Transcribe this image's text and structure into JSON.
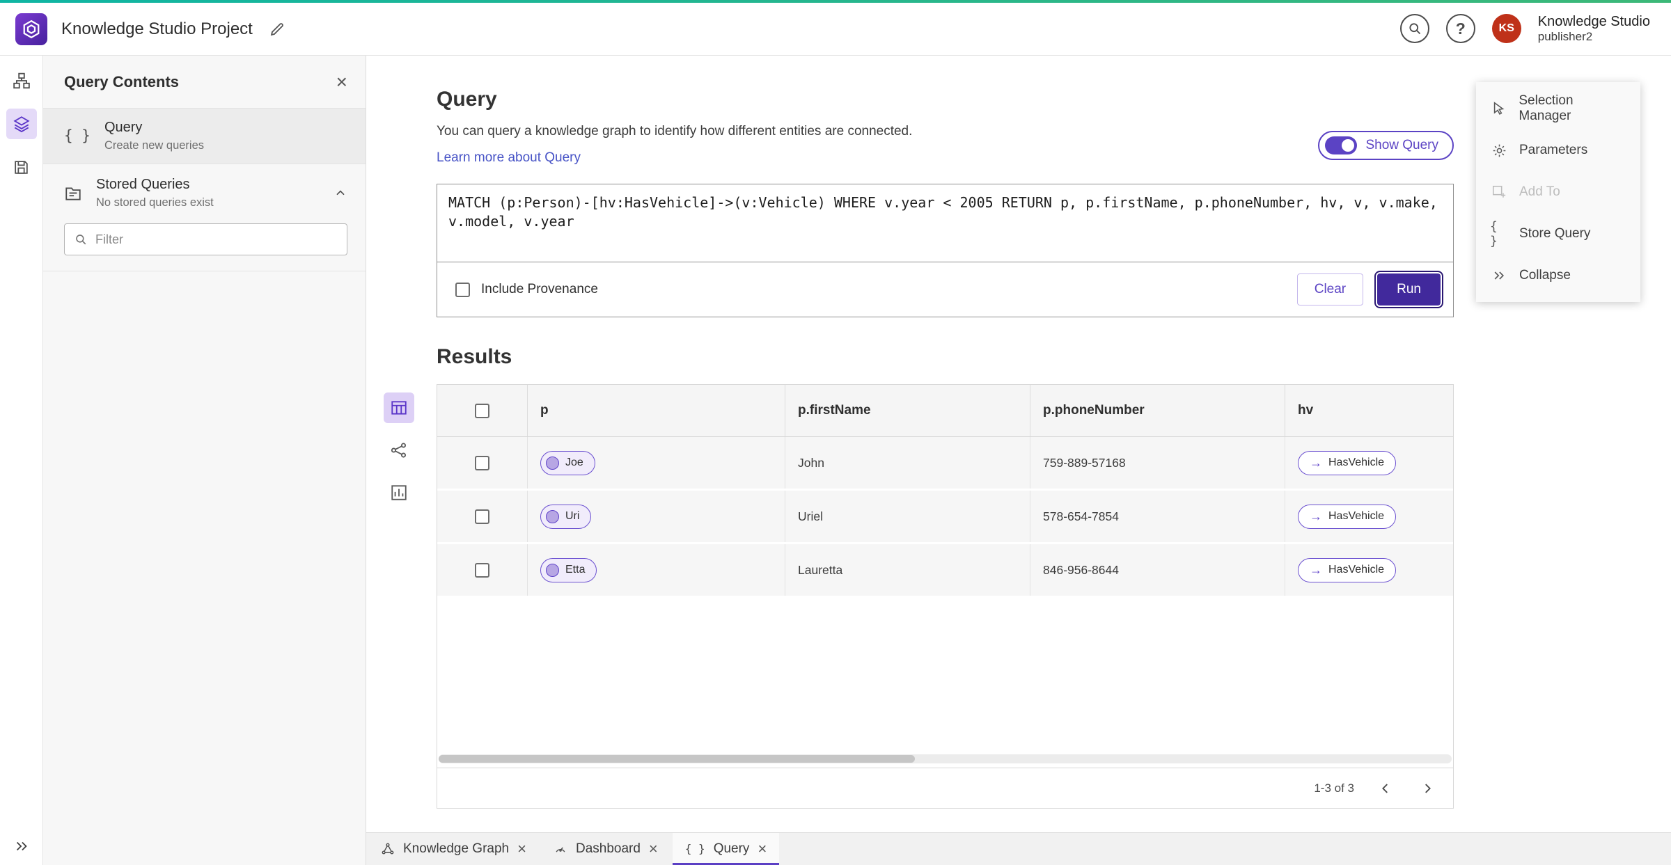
{
  "theme": {
    "primary_purple": "#5b43c4",
    "deep_purple": "#41299c",
    "avatar_red": "#bf3119",
    "accent_teal": "#0fb5a3",
    "selected_light_purple": "#e4daf8"
  },
  "icons": {
    "rail": [
      "sitemap-icon",
      "layers-icon",
      "save-icon",
      "expand-icon"
    ],
    "results_views": [
      "table-view-icon",
      "graph-view-icon",
      "chart-view-icon"
    ],
    "edge_arrow": "→"
  },
  "header": {
    "project_title": "Knowledge Studio Project",
    "user_name": "Knowledge Studio",
    "user_role": "publisher2",
    "avatar_initials": "KS"
  },
  "left_panel": {
    "title": "Query Contents",
    "query_item": {
      "title": "Query",
      "subtitle": "Create new queries"
    },
    "stored_queries": {
      "title": "Stored Queries",
      "subtitle": "No stored queries exist"
    },
    "filter_placeholder": "Filter"
  },
  "query_panel": {
    "title": "Query",
    "description": "You can query a knowledge graph to identify how different entities are connected.",
    "learn_more_link": "Learn more about Query",
    "show_query_label": "Show Query",
    "query_text": "MATCH (p:Person)-[hv:HasVehicle]->(v:Vehicle) WHERE v.year < 2005 RETURN p, p.firstName, p.phoneNumber, hv, v, v.make, v.model, v.year",
    "include_provenance_label": "Include Provenance",
    "clear_button": "Clear",
    "run_button": "Run"
  },
  "results": {
    "title": "Results",
    "columns": [
      "p",
      "p.firstName",
      "p.phoneNumber",
      "hv"
    ],
    "rows": [
      {
        "p_node": "Joe",
        "first_name": "John",
        "phone_number": "759-889-57168",
        "hv_edge": "HasVehicle"
      },
      {
        "p_node": "Uri",
        "first_name": "Uriel",
        "phone_number": "578-654-7854",
        "hv_edge": "HasVehicle"
      },
      {
        "p_node": "Etta",
        "first_name": "Lauretta",
        "phone_number": "846-956-8644",
        "hv_edge": "HasVehicle"
      }
    ],
    "pagination": {
      "range_label": "1-3 of 3"
    }
  },
  "context_menu": {
    "items": [
      {
        "label": "Selection Manager",
        "disabled": false
      },
      {
        "label": "Parameters",
        "disabled": false
      },
      {
        "label": "Add To",
        "disabled": true
      },
      {
        "label": "Store Query",
        "disabled": false
      },
      {
        "label": "Collapse",
        "disabled": false
      }
    ]
  },
  "tabs": [
    {
      "label": "Knowledge Graph",
      "active": false
    },
    {
      "label": "Dashboard",
      "active": false
    },
    {
      "label": "Query",
      "active": true
    }
  ]
}
